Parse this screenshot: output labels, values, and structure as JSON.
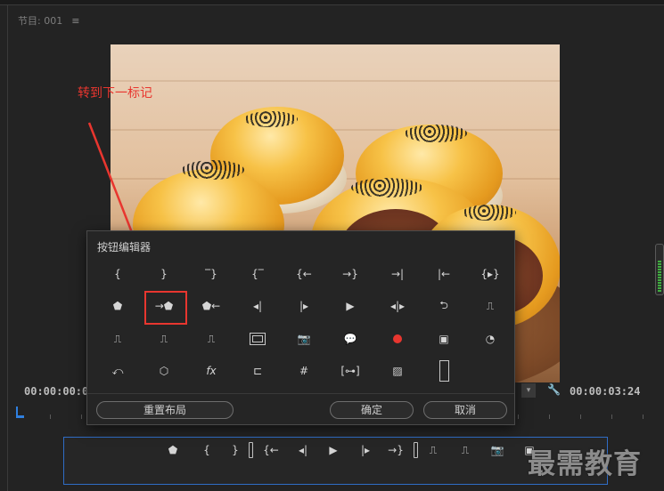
{
  "panel": {
    "title": "节目: 001",
    "menu_icon": "≡"
  },
  "annotation": {
    "text": "转到下一标记",
    "color": "#e8362f"
  },
  "timecodes": {
    "left": "00:00:00:00",
    "right": "00:00:03:24"
  },
  "editor": {
    "title": "按钮编辑器",
    "icons": [
      [
        "mark-in-icon",
        "{"
      ],
      [
        "mark-out-icon",
        "}"
      ],
      [
        "clear-in-icon",
        "‾}"
      ],
      [
        "clear-out-icon",
        "{‾"
      ],
      [
        "go-to-in-icon",
        "{←"
      ],
      [
        "go-to-out-icon",
        "→}"
      ],
      [
        "go-to-next-edit-icon",
        "→|"
      ],
      [
        "go-to-prev-edit-icon",
        "|←"
      ],
      [
        "play-in-to-out-icon",
        "{▸}"
      ],
      [
        "add-marker-icon",
        "⬟"
      ],
      [
        "go-to-next-marker-icon",
        "→⬟"
      ],
      [
        "go-to-prev-marker-icon",
        "⬟←"
      ],
      [
        "step-back-icon",
        "◂|"
      ],
      [
        "step-forward-icon",
        "|▸"
      ],
      [
        "play-stop-icon",
        "▶"
      ],
      [
        "play-around-icon",
        "◂|▸"
      ],
      [
        "loop-icon",
        "⮌"
      ],
      [
        "lift-icon",
        "⎍"
      ],
      [
        "insert-icon",
        "⎍"
      ],
      [
        "overwrite-icon",
        "⎍"
      ],
      [
        "extract-icon",
        "⎍"
      ],
      [
        "safe-margins-icon",
        "▭"
      ],
      [
        "export-frame-icon",
        "📷"
      ],
      [
        "comment-icon",
        "💬"
      ],
      [
        "record-icon",
        "●"
      ],
      [
        "multicam-icon",
        "▣"
      ],
      [
        "vr-icon",
        "◔"
      ],
      [
        "restore-crop-icon",
        "⤺"
      ],
      [
        "vr-video-icon",
        "⬡"
      ],
      [
        "fx-icon",
        "fx"
      ],
      [
        "show-rulers-icon",
        "⊏"
      ],
      [
        "show-guides-icon",
        "#"
      ],
      [
        "snap-icon",
        "[⊶]"
      ],
      [
        "comparison-view-icon",
        "▨"
      ],
      [
        "spacer-icon",
        "▯"
      ]
    ],
    "selected_icon_index": 10,
    "buttons": {
      "reset": "重置布局",
      "ok": "确定",
      "cancel": "取消"
    }
  },
  "bottom_toolbar": {
    "icons": [
      "⬟",
      "{",
      "}",
      "",
      "{←",
      "◂|",
      "▶",
      "|▸",
      "→}",
      "",
      "⎍",
      "⎍",
      "📷",
      "▣"
    ]
  },
  "watermark": {
    "text": "最需教育"
  },
  "colors": {
    "accent": "#2f6cc5",
    "annotation": "#e8362f",
    "panel_bg": "#232323"
  }
}
